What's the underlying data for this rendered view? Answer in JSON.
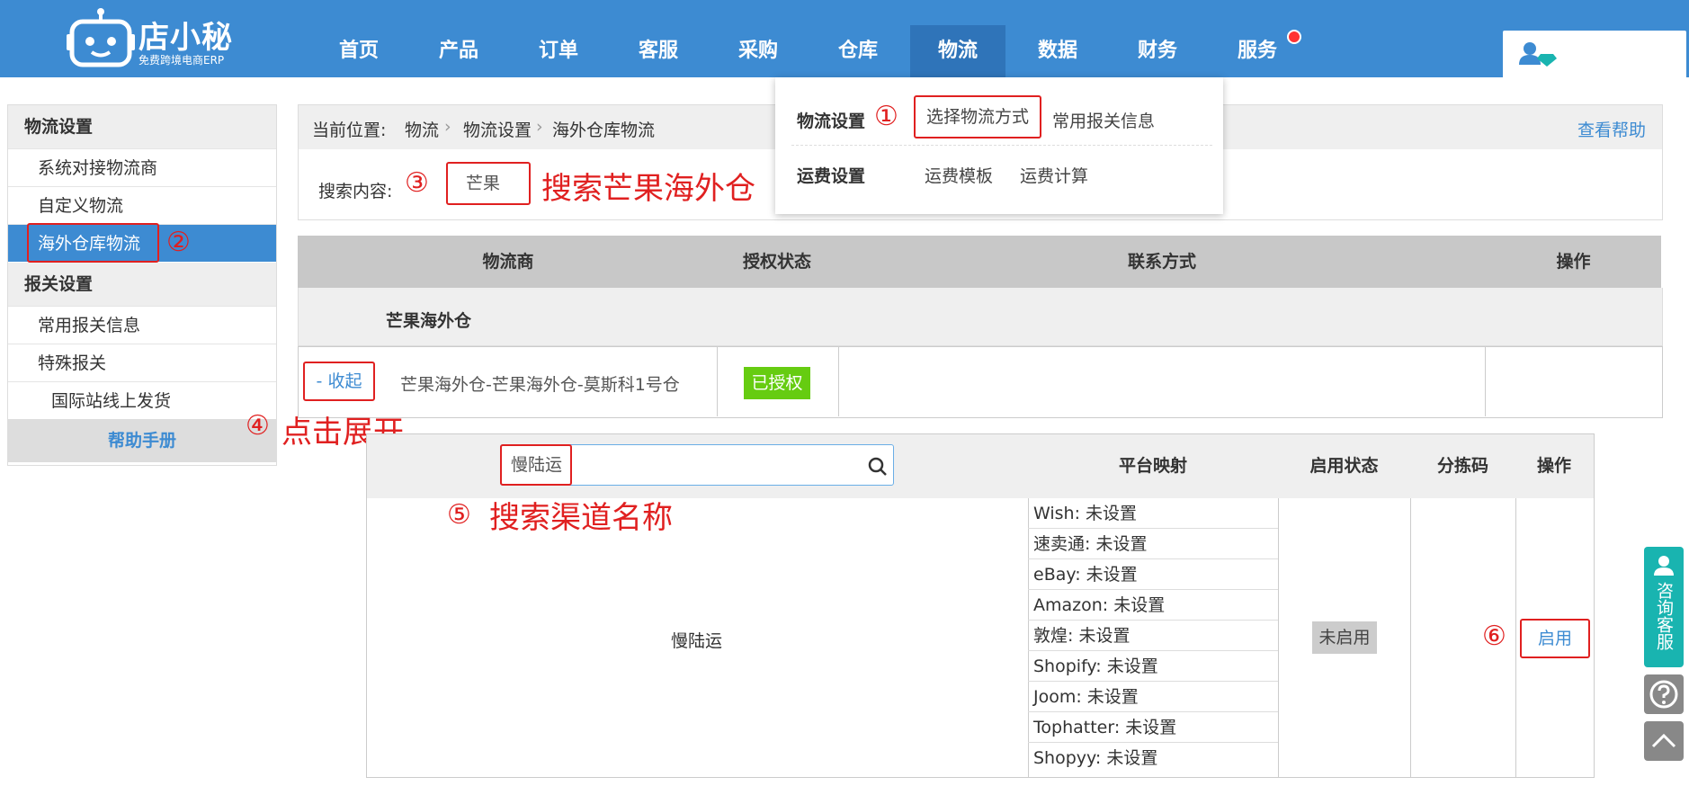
{
  "brand": {
    "name": "店小秘",
    "tagline": "免费跨境电商ERP"
  },
  "nav": {
    "items": [
      "首页",
      "产品",
      "订单",
      "客服",
      "采购",
      "仓库",
      "物流",
      "数据",
      "财务",
      "服务"
    ],
    "active": "物流"
  },
  "dropdown": {
    "group1_title": "物流设置",
    "group1_links": [
      "选择物流方式",
      "常用报关信息"
    ],
    "group2_title": "运费设置",
    "group2_links": [
      "运费模板",
      "运费计算"
    ]
  },
  "sidebar": {
    "section1": "物流设置",
    "section1_items": [
      "系统对接物流商",
      "自定义物流",
      "海外仓库物流"
    ],
    "section2": "报关设置",
    "section2_items": [
      "常用报关信息",
      "特殊报关",
      "国际站线上发货"
    ],
    "help": "帮助手册"
  },
  "breadcrumb": {
    "label": "当前位置:",
    "items": [
      "物流",
      "物流设置",
      "海外仓库物流"
    ],
    "help_link": "查看帮助"
  },
  "search": {
    "label": "搜索内容:",
    "value": "芒果"
  },
  "table": {
    "headers": [
      "物流商",
      "授权状态",
      "联系方式",
      "操作"
    ],
    "group_name": "芒果海外仓",
    "row": {
      "toggle": "- 收起",
      "name": "芒果海外仓-芒果海外仓-莫斯科1号仓",
      "status": "已授权"
    }
  },
  "subtable": {
    "search_value": "慢陆运",
    "headers": [
      "平台映射",
      "启用状态",
      "分拣码",
      "操作"
    ],
    "channel_name": "慢陆运",
    "mappings": [
      "Wish: 未设置",
      "速卖通: 未设置",
      "eBay: 未设置",
      "Amazon: 未设置",
      "敦煌: 未设置",
      "Shopify: 未设置",
      "Joom: 未设置",
      "Tophatter: 未设置",
      "Shopyy: 未设置"
    ],
    "status": "未启用",
    "action": "启用"
  },
  "annotations": {
    "n1": "①",
    "n2": "②",
    "n3": "③",
    "n4": "④",
    "n5": "⑤",
    "n6": "⑥",
    "t3": "搜索芒果海外仓",
    "t4": "点击展开",
    "t5": "搜索渠道名称"
  },
  "float": {
    "cs_label": "咨询客服"
  },
  "colors": {
    "primary": "#3d8bd2",
    "nav_active": "#2f74b9",
    "authorized": "#66cc11",
    "annotation": "#e02020",
    "cs": "#19b4b0"
  }
}
